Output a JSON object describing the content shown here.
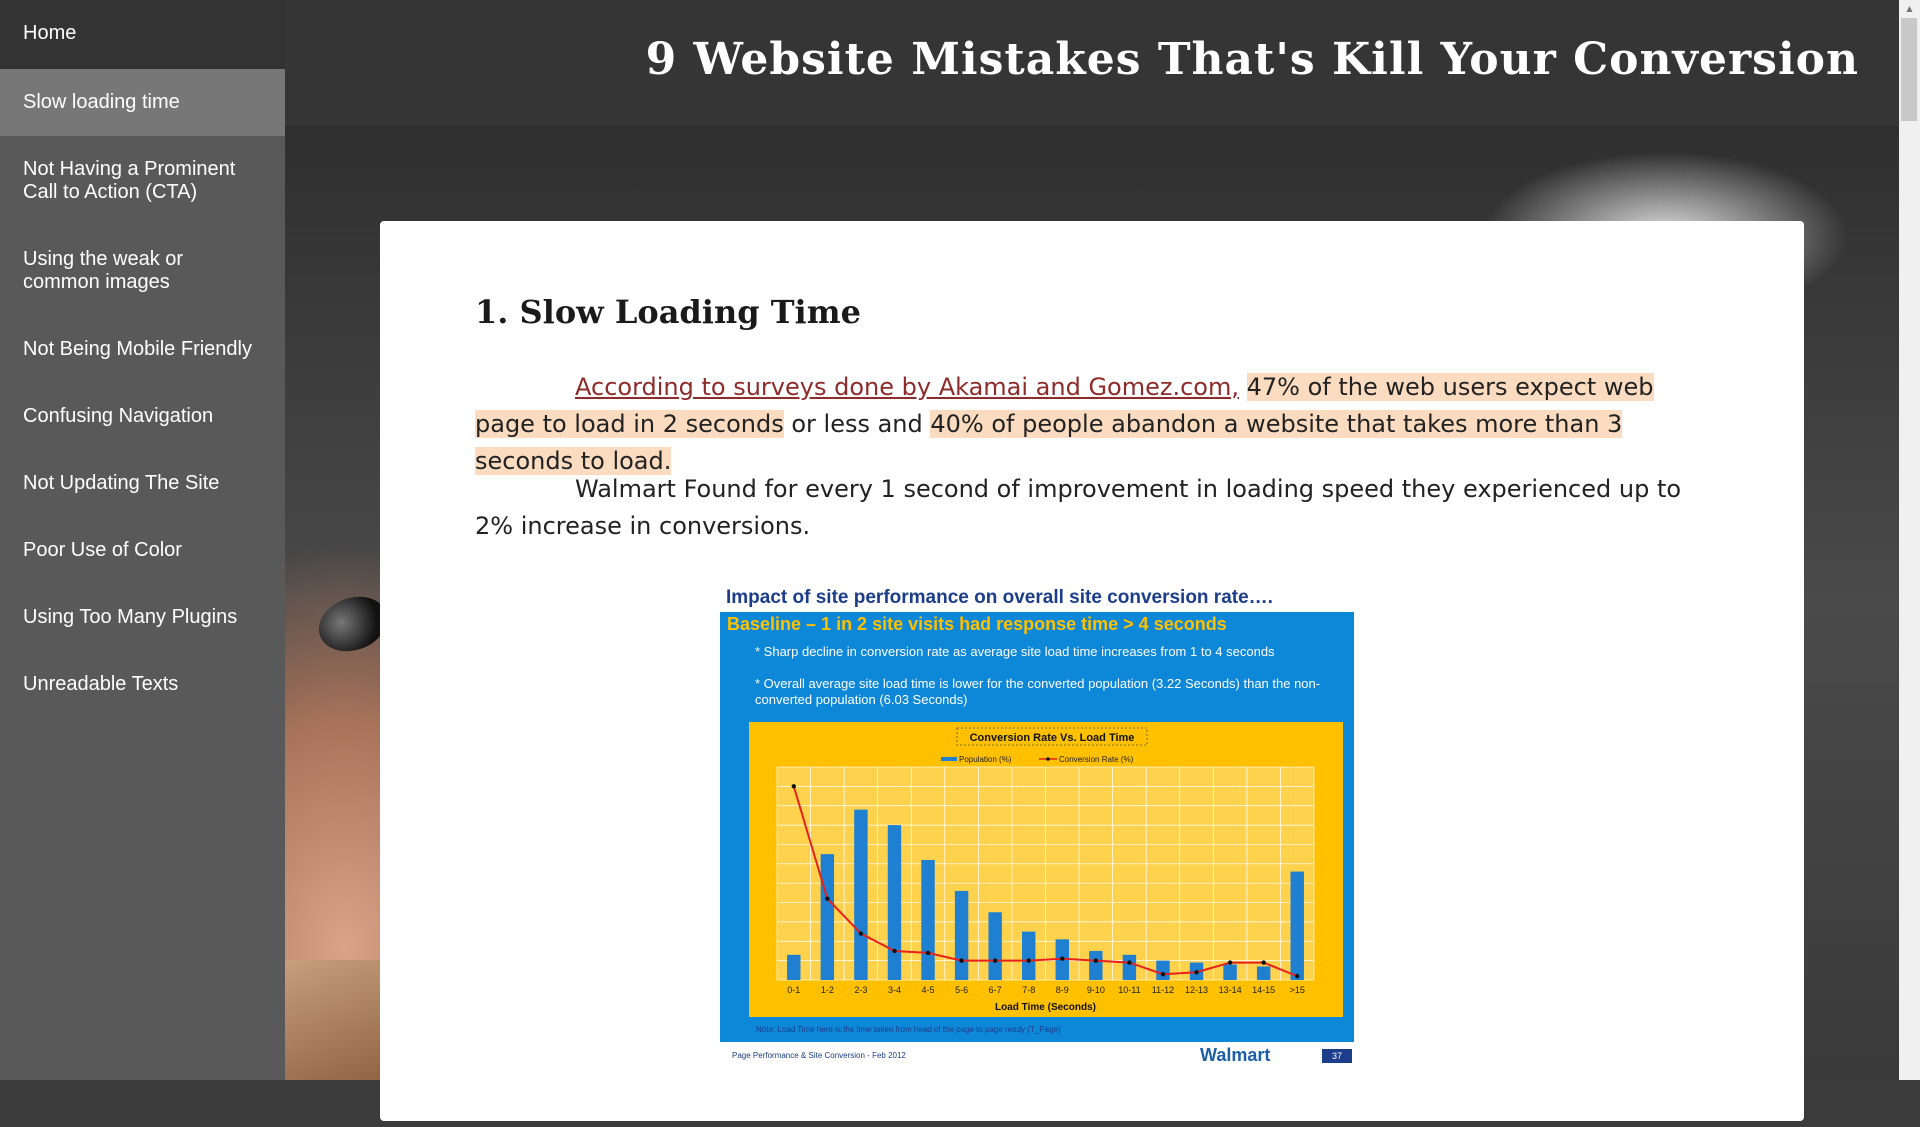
{
  "sidebar": {
    "items": [
      {
        "label": "Home"
      },
      {
        "label": "Slow loading time"
      },
      {
        "label": "Not Having a Prominent Call to Action (CTA)"
      },
      {
        "label": "Using the weak or common images"
      },
      {
        "label": "Not Being Mobile Friendly"
      },
      {
        "label": "Confusing Navigation"
      },
      {
        "label": "Not Updating The Site"
      },
      {
        "label": "Poor Use of Color"
      },
      {
        "label": "Using Too Many Plugins"
      },
      {
        "label": "Unreadable Texts"
      }
    ]
  },
  "header": {
    "title": "9 Website Mistakes That's Kill Your Conversion"
  },
  "main": {
    "heading": "1. Slow Loading Time",
    "p1": {
      "link": "According to surveys done by Akamai and Gomez.com,",
      "hl1": "47% of the web users expect web page to load in 2 seconds",
      "mid": " or less and ",
      "hl2": "40% of people abandon a website that takes more than 3 seconds to load."
    },
    "p2": "Walmart Found for every 1 second of improvement in loading speed they experienced up to 2% increase in conversions.",
    "slide": {
      "caption": "Impact of site performance on overall site conversion rate….",
      "headline": "Baseline – 1 in 2 site visits had response time > 4 seconds",
      "bullet1": "* Sharp decline in conversion rate as average site load time increases from 1 to 4 seconds",
      "bullet2": "* Overall average site load time is lower for the converted population (3.22 Seconds) than the non-converted population (6.03 Seconds)",
      "note": "Note: Load Time here is the time taken from head of the page to page ready (T_Page)",
      "footer": "Page Performance & Site Conversion - Feb 2012",
      "logo": "Walmart",
      "page_number": "37"
    }
  },
  "chart_data": {
    "type": "bar",
    "title": "Conversion Rate Vs. Load Time",
    "xlabel": "Load Time (Seconds)",
    "ylabel": "",
    "categories": [
      "0-1",
      "1-2",
      "2-3",
      "3-4",
      "4-5",
      "5-6",
      "6-7",
      "7-8",
      "8-9",
      "9-10",
      "10-11",
      "11-12",
      "12-13",
      "13-14",
      "14-15",
      ">15"
    ],
    "series": [
      {
        "name": "Population (%)",
        "kind": "bar",
        "color": "#1f7fd1",
        "values": [
          1.3,
          6.5,
          8.8,
          8.0,
          6.2,
          4.6,
          3.5,
          2.5,
          2.1,
          1.5,
          1.3,
          1.0,
          0.9,
          0.8,
          0.7,
          5.6
        ]
      },
      {
        "name": "Conversion Rate (%)",
        "kind": "line",
        "color": "#e8201c",
        "values": [
          10.0,
          4.2,
          2.4,
          1.5,
          1.4,
          1.0,
          1.0,
          1.0,
          1.1,
          1.0,
          0.9,
          0.3,
          0.4,
          0.9,
          0.9,
          0.2
        ]
      }
    ],
    "ylim": [
      0,
      11
    ],
    "grid": true,
    "legend": "top"
  },
  "scrollbar": {
    "up_arrow": "▲"
  }
}
